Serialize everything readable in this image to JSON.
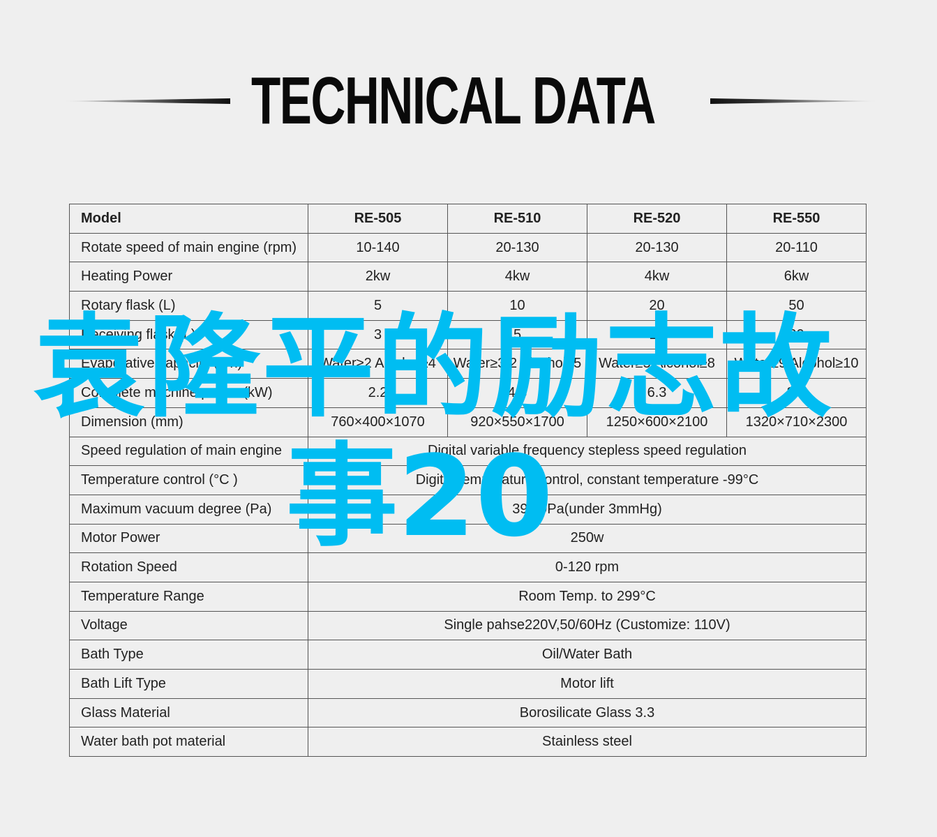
{
  "header": {
    "title": "TECHNICAL DATA"
  },
  "table": {
    "columns": [
      "Model",
      "RE-505",
      "RE-510",
      "RE-520",
      "RE-550"
    ],
    "rows_per_model": [
      {
        "label": "Rotate speed of main engine (rpm)",
        "values": [
          "10-140",
          "20-130",
          "20-130",
          "20-110"
        ]
      },
      {
        "label": "Heating Power",
        "values": [
          "2kw",
          "4kw",
          "4kw",
          "6kw"
        ]
      },
      {
        "label": "Rotary flask (L)",
        "values": [
          "5",
          "10",
          "20",
          "50"
        ]
      },
      {
        "label": "Receiving flask (L)",
        "values": [
          "3",
          "5",
          "10",
          "20"
        ]
      },
      {
        "label": "Evaporative capacity (L/h)",
        "values": [
          "Water≥2 Alcohol≥4",
          "Water≥3.2 Alcohol≥5",
          "Water≥5 Alcohol≥8",
          "Water≥9 Alcohol≥10"
        ]
      },
      {
        "label": "Complete machine power (kW)",
        "values": [
          "2.2",
          "4.8",
          "6.3",
          "8.3"
        ]
      },
      {
        "label": "Dimension (mm)",
        "values": [
          "760×400×1070",
          "920×550×1700",
          "1250×600×2100",
          "1320×710×2300"
        ]
      }
    ],
    "rows_shared": [
      {
        "label": "Speed regulation of main engine",
        "value": "Digital variable frequency stepless speed regulation"
      },
      {
        "label": "Temperature control (°C )",
        "value": "Digital temperature control, constant temperature -99°C"
      },
      {
        "label": "Maximum vacuum degree (Pa)",
        "value": "399.9Pa(under 3mmHg)"
      },
      {
        "label": "Motor Power",
        "value": "250w"
      },
      {
        "label": "Rotation Speed",
        "value": "0-120 rpm"
      },
      {
        "label": "Temperature Range",
        "value": "Room Temp. to 299°C"
      },
      {
        "label": "Voltage",
        "value": "Single pahse220V,50/60Hz (Customize: 110V)"
      },
      {
        "label": "Bath Type",
        "value": "Oil/Water Bath"
      },
      {
        "label": "Bath Lift Type",
        "value": "Motor lift"
      },
      {
        "label": "Glass Material",
        "value": "Borosilicate Glass 3.3"
      },
      {
        "label": "Water bath pot material",
        "value": "Stainless steel"
      }
    ]
  },
  "overlay": {
    "line1": "袁隆平的励志故",
    "line2": "事20",
    "color": "#00bdf2"
  }
}
